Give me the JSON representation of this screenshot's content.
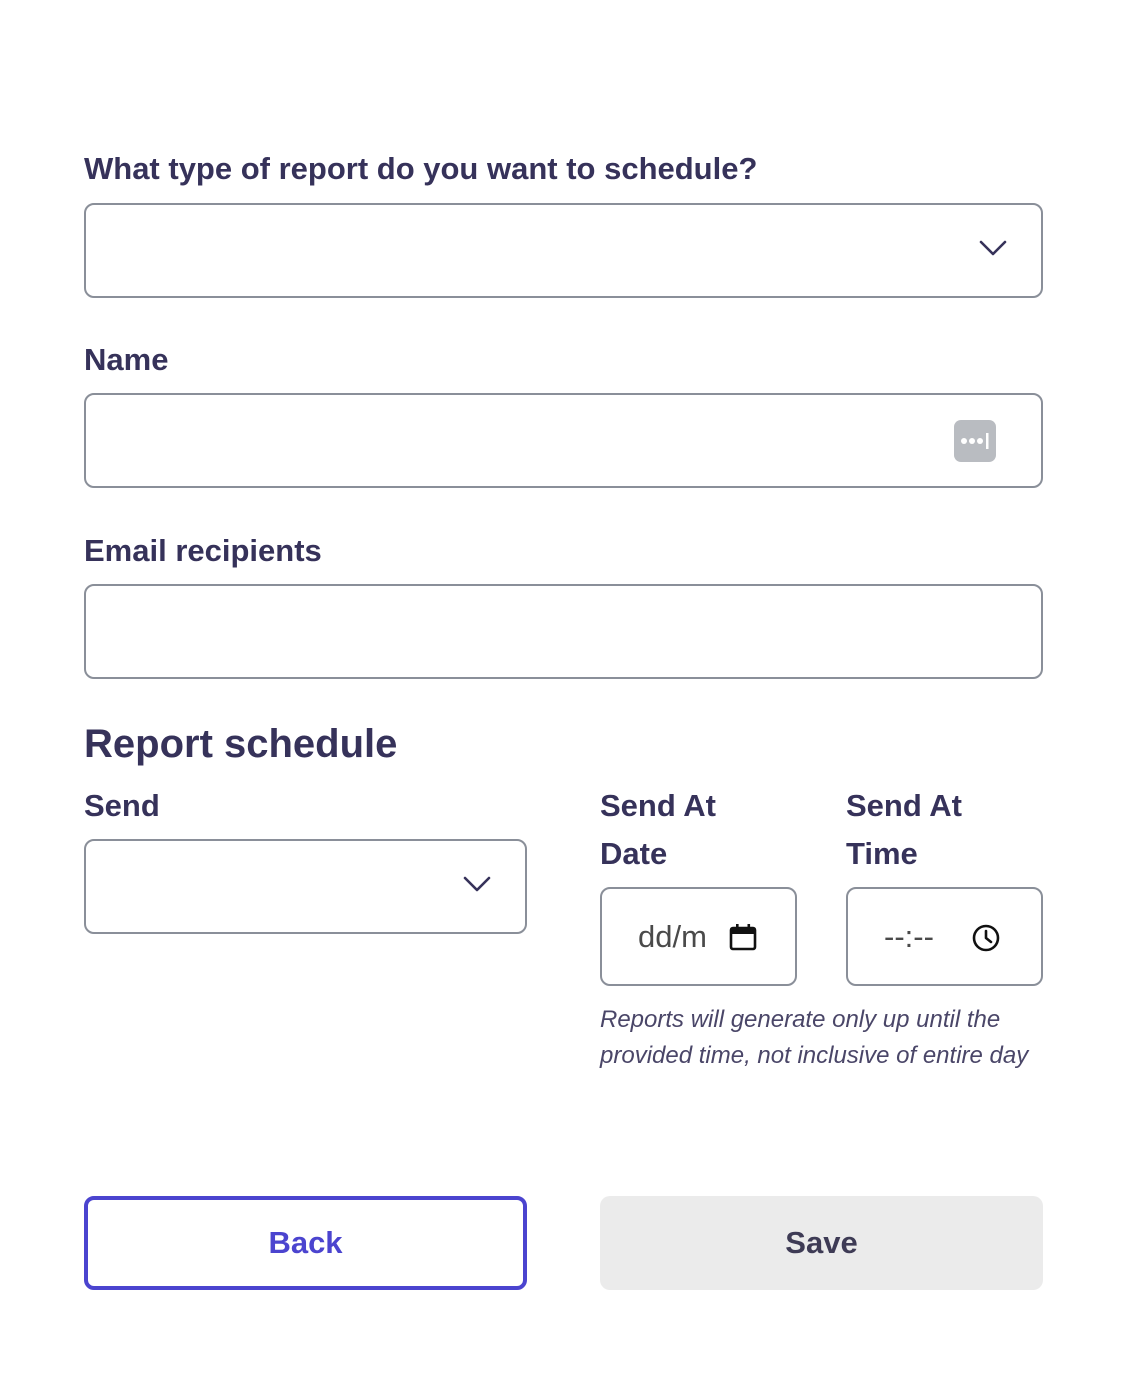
{
  "report_type": {
    "label": "What type of report do you want to schedule?",
    "value": ""
  },
  "name": {
    "label": "Name",
    "value": ""
  },
  "email": {
    "label": "Email recipients",
    "value": ""
  },
  "schedule": {
    "heading": "Report schedule",
    "send_label": "Send",
    "date_label_line1": "Send At",
    "date_label_line2": "Date",
    "time_label_line1": "Send At",
    "time_label_line2": "Time",
    "date_placeholder": "dd/m",
    "time_placeholder": "--:--",
    "note_line1": "Reports will generate only up until the",
    "note_line2": "provided time, not inclusive of entire day"
  },
  "buttons": {
    "back": "Back",
    "save": "Save"
  },
  "icons": {
    "report_type_dropdown": "chevron-down-icon",
    "name_autofill": "password-manager-icon",
    "send_dropdown": "chevron-down-icon",
    "date": "calendar-icon",
    "time": "clock-icon"
  },
  "colors": {
    "text": "#36325a",
    "accent": "#4b44cf",
    "border": "#8a8f99",
    "disabled_bg": "#ebebeb"
  }
}
